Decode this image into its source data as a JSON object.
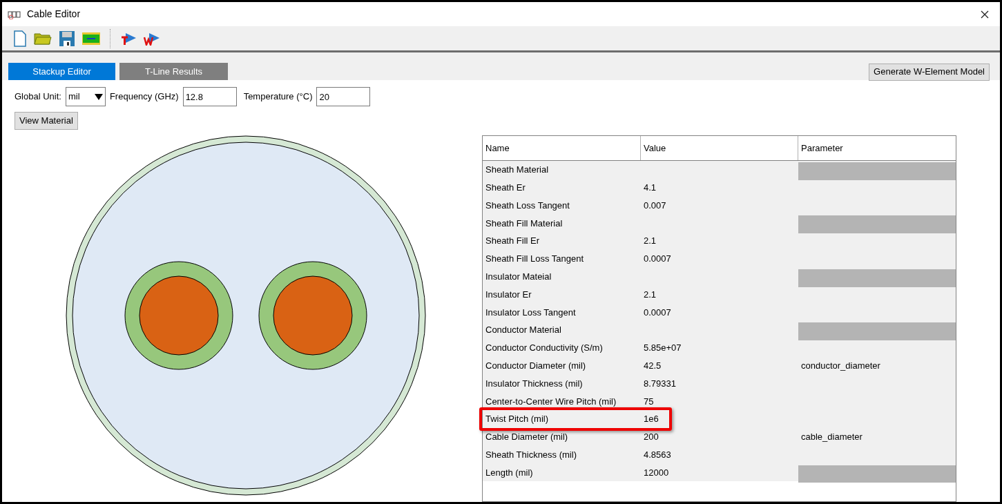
{
  "window": {
    "title": "Cable Editor"
  },
  "tabs": [
    {
      "label": "Stackup Editor",
      "selected": true
    },
    {
      "label": "T-Line Results",
      "selected": false
    }
  ],
  "generate_button": "Generate W-Element Model",
  "settings": {
    "unit_label": "Global Unit:",
    "unit_value": "mil",
    "frequency_label": "Frequency (GHz)",
    "frequency_value": "12.8",
    "temperature_label": "Temperature (°C)",
    "temperature_value": "20"
  },
  "view_material_button": "View Material",
  "table": {
    "columns": [
      "Name",
      "Value",
      "Parameter"
    ],
    "rows": [
      {
        "name": "Sheath Material",
        "value": "",
        "parameter": "",
        "parameter_disabled": true,
        "highlighted": false
      },
      {
        "name": "Sheath Er",
        "value": "4.1",
        "parameter": "",
        "parameter_disabled": false,
        "highlighted": false
      },
      {
        "name": "Sheath Loss Tangent",
        "value": "0.007",
        "parameter": "",
        "parameter_disabled": false,
        "highlighted": false
      },
      {
        "name": "Sheath Fill Material",
        "value": "",
        "parameter": "",
        "parameter_disabled": true,
        "highlighted": false
      },
      {
        "name": "Sheath Fill Er",
        "value": "2.1",
        "parameter": "",
        "parameter_disabled": false,
        "highlighted": false
      },
      {
        "name": "Sheath Fill Loss Tangent",
        "value": "0.0007",
        "parameter": "",
        "parameter_disabled": false,
        "highlighted": false
      },
      {
        "name": "Insulator Mateial",
        "value": "",
        "parameter": "",
        "parameter_disabled": true,
        "highlighted": false
      },
      {
        "name": "Insulator Er",
        "value": "2.1",
        "parameter": "",
        "parameter_disabled": false,
        "highlighted": false
      },
      {
        "name": "Insulator Loss Tangent",
        "value": "0.0007",
        "parameter": "",
        "parameter_disabled": false,
        "highlighted": false
      },
      {
        "name": "Conductor Material",
        "value": "",
        "parameter": "",
        "parameter_disabled": true,
        "highlighted": false
      },
      {
        "name": "Conductor Conductivity (S/m)",
        "value": "5.85e+07",
        "parameter": "",
        "parameter_disabled": false,
        "highlighted": false
      },
      {
        "name": "Conductor Diameter (mil)",
        "value": "42.5",
        "parameter": "conductor_diameter",
        "parameter_disabled": false,
        "highlighted": false
      },
      {
        "name": "Insulator Thickness (mil)",
        "value": "8.79331",
        "parameter": "",
        "parameter_disabled": false,
        "highlighted": false
      },
      {
        "name": "Center-to-Center Wire Pitch (mil)",
        "value": "75",
        "parameter": "",
        "parameter_disabled": false,
        "highlighted": false
      },
      {
        "name": "Twist Pitch (mil)",
        "value": "1e6",
        "parameter": "",
        "parameter_disabled": false,
        "highlighted": true
      },
      {
        "name": "Cable Diameter (mil)",
        "value": "200",
        "parameter": "cable_diameter",
        "parameter_disabled": false,
        "highlighted": false
      },
      {
        "name": "Sheath Thickness (mil)",
        "value": "4.8563",
        "parameter": "",
        "parameter_disabled": false,
        "highlighted": false
      },
      {
        "name": "Length (mil)",
        "value": "12000",
        "parameter": "",
        "parameter_disabled": true,
        "highlighted": false
      }
    ]
  }
}
